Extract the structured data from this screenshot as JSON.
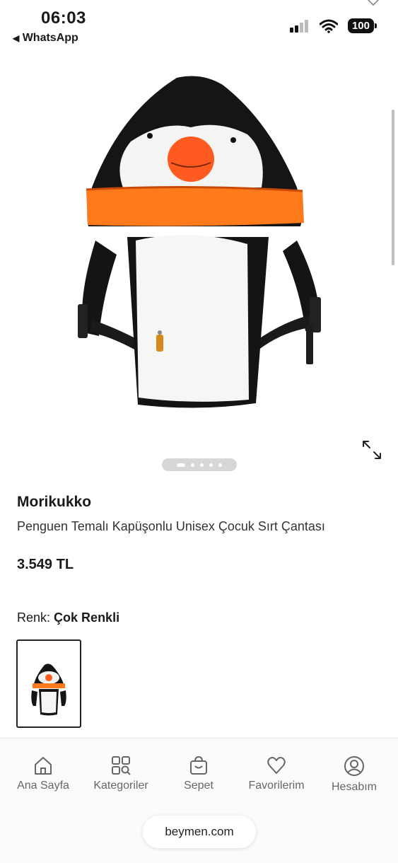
{
  "status_bar": {
    "time": "06:03",
    "back_app": "WhatsApp",
    "battery": "100"
  },
  "gallery": {
    "image_count": 5,
    "active_index": 0
  },
  "product": {
    "brand": "Morikukko",
    "name": "Penguen Temalı Kapüşonlu Unisex Çocuk Sırt Çantası",
    "price": "3.549 TL",
    "color_label": "Renk:",
    "color_value": "Çok Renkli"
  },
  "nav": {
    "items": [
      {
        "label": "Ana Sayfa",
        "icon": "home-icon"
      },
      {
        "label": "Kategoriler",
        "icon": "categories-icon"
      },
      {
        "label": "Sepet",
        "icon": "bag-icon"
      },
      {
        "label": "Favorilerim",
        "icon": "heart-icon"
      },
      {
        "label": "Hesabım",
        "icon": "user-icon"
      }
    ]
  },
  "browser": {
    "url": "beymen.com"
  },
  "colors": {
    "penguin_black": "#111111",
    "penguin_orange": "#ff5a1f",
    "mesh_orange": "#ff7a1a",
    "fur_white": "#f6f6f4"
  }
}
